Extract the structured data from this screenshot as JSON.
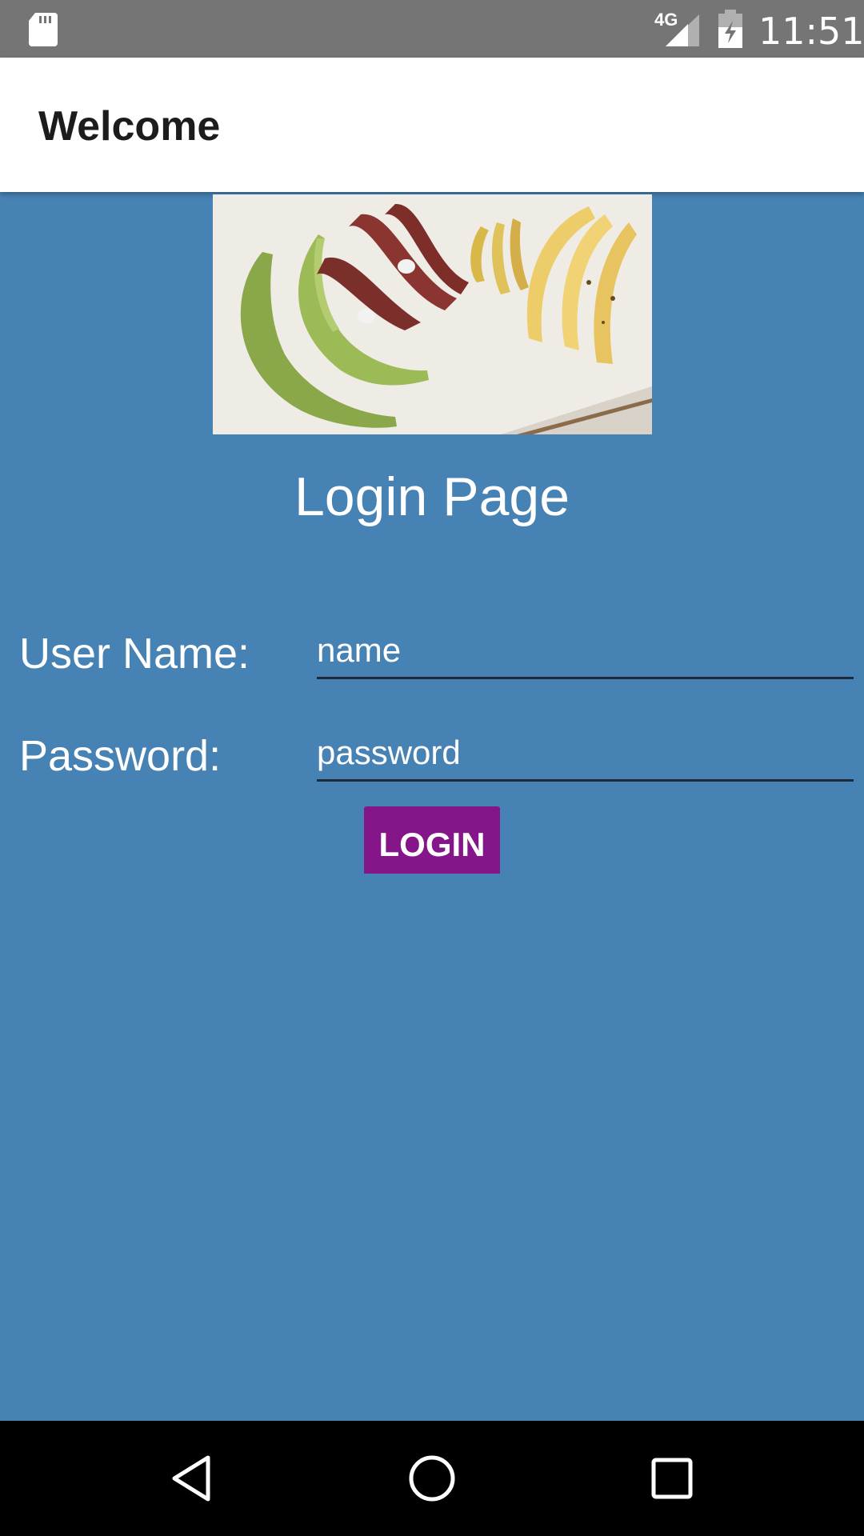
{
  "status_bar": {
    "time": "11:51",
    "network_label": "4G",
    "icons": [
      "sd-card-icon",
      "signal-4g-icon",
      "battery-charging-icon"
    ]
  },
  "app_bar": {
    "title": "Welcome"
  },
  "hero_image": {
    "description_icon": "bananas-photo"
  },
  "heading": "Login Page",
  "form": {
    "username_label": "User Name:",
    "username_placeholder": "name",
    "password_label": "Password:",
    "password_placeholder": "password",
    "login_label": "LOGIN"
  },
  "nav_bar": {
    "icons": [
      "back-icon",
      "home-icon",
      "recents-icon"
    ]
  },
  "colors": {
    "background": "#4682b4",
    "status_bar": "#757575",
    "app_bar": "#ffffff",
    "button": "#85168a",
    "nav_bar": "#000000"
  }
}
